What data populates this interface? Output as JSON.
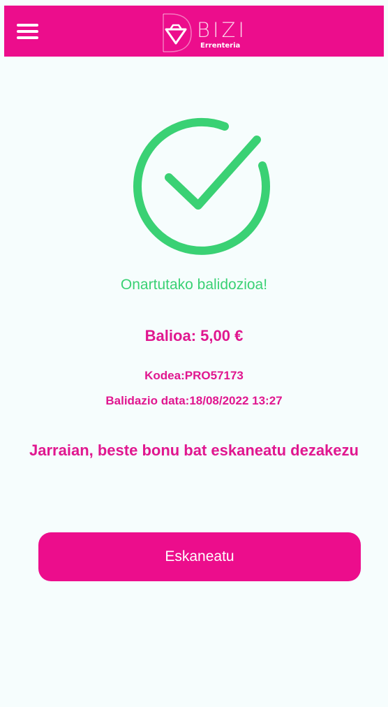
{
  "app_bar": {
    "logo_name": "BIZI",
    "logo_subtitle": "Errenteria",
    "menu_icon": "hamburger-menu-icon",
    "background_color": "#ec0d8c"
  },
  "result": {
    "icon": "checkmark-circle-icon",
    "icon_color": "#3ad174",
    "status_message": "Onartutako balidozioa!",
    "value_text": "Balioa: 5,00 €",
    "code_text": "Kodea:PRO57173",
    "validation_date_text": "Balidazio data:18/08/2022 13:27"
  },
  "prompt": {
    "text": "Jarraian, beste bonu bat eskaneatu dezakezu"
  },
  "actions": {
    "scan_button_label": "Eskaneatu"
  },
  "colors": {
    "accent": "#ec0d8c",
    "text_accent": "#e0178f",
    "success": "#3ad174",
    "background": "#f6fdfd"
  }
}
